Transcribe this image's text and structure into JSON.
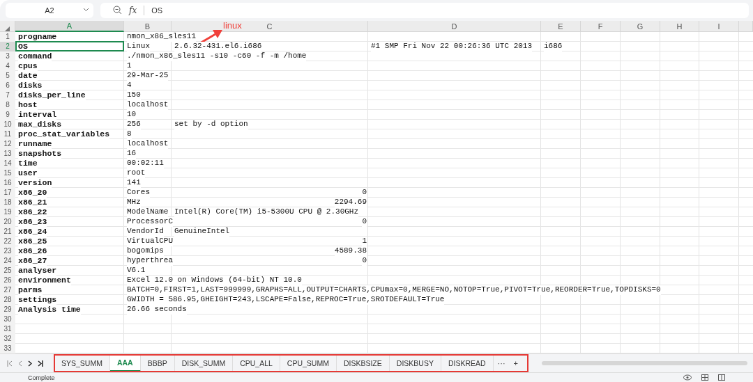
{
  "formula_bar": {
    "name_box": "A2",
    "fx": "fx",
    "value": "OS"
  },
  "columns": [
    {
      "label": "A",
      "selected": true
    },
    {
      "label": "B",
      "selected": false
    },
    {
      "label": "C",
      "selected": false
    },
    {
      "label": "D",
      "selected": false
    },
    {
      "label": "E",
      "selected": false
    },
    {
      "label": "F",
      "selected": false
    },
    {
      "label": "G",
      "selected": false
    },
    {
      "label": "H",
      "selected": false
    },
    {
      "label": "I",
      "selected": false
    }
  ],
  "rows": [
    {
      "number": "1",
      "selected": false,
      "a": "progname",
      "b": "nmon_x86_sles11"
    },
    {
      "number": "2",
      "selected": true,
      "a": "OS",
      "b": "Linux",
      "c": "2.6.32-431.el6.i686",
      "d": "#1 SMP Fri Nov 22 00:26:36 UTC 2013",
      "e": "i686"
    },
    {
      "number": "3",
      "selected": false,
      "a": "command",
      "b": "./nmon_x86_sles11 -s10 -c60 -f -m /home"
    },
    {
      "number": "4",
      "selected": false,
      "a": "cpus",
      "b": "1"
    },
    {
      "number": "5",
      "selected": false,
      "a": "date",
      "b": "29-Mar-25"
    },
    {
      "number": "6",
      "selected": false,
      "a": "disks",
      "b": "4"
    },
    {
      "number": "7",
      "selected": false,
      "a": "disks_per_line",
      "b": "150"
    },
    {
      "number": "8",
      "selected": false,
      "a": "host",
      "b": "localhost"
    },
    {
      "number": "9",
      "selected": false,
      "a": "interval",
      "b": "10"
    },
    {
      "number": "10",
      "selected": false,
      "a": "max_disks",
      "b": "256",
      "c": "set by -d option"
    },
    {
      "number": "11",
      "selected": false,
      "a": "proc_stat_variables",
      "b": "8"
    },
    {
      "number": "12",
      "selected": false,
      "a": "runname",
      "b": "localhost"
    },
    {
      "number": "13",
      "selected": false,
      "a": "snapshots",
      "b": "16"
    },
    {
      "number": "14",
      "selected": false,
      "a": "time",
      "b": "00:02:11"
    },
    {
      "number": "15",
      "selected": false,
      "a": "user",
      "b": "root"
    },
    {
      "number": "16",
      "selected": false,
      "a": "version",
      "b": "14i"
    },
    {
      "number": "17",
      "selected": false,
      "a": "x86_20",
      "b": "Cores",
      "c": "0",
      "c_numeric": true
    },
    {
      "number": "18",
      "selected": false,
      "a": "x86_21",
      "b": "MHz",
      "c": "2294.69",
      "c_numeric": true
    },
    {
      "number": "19",
      "selected": false,
      "a": "x86_22",
      "b": "ModelName",
      "c": "Intel(R) Core(TM) i5-5300U CPU @ 2.30GHz"
    },
    {
      "number": "20",
      "selected": false,
      "a": "x86_23",
      "b": "ProcessorC",
      "c": "0",
      "c_numeric": true
    },
    {
      "number": "21",
      "selected": false,
      "a": "x86_24",
      "b": "VendorId",
      "c": "GenuineIntel"
    },
    {
      "number": "22",
      "selected": false,
      "a": "x86_25",
      "b": "VirtualCPU",
      "c": "1",
      "c_numeric": true
    },
    {
      "number": "23",
      "selected": false,
      "a": "x86_26",
      "b": "bogomips",
      "c": "4589.38",
      "c_numeric": true
    },
    {
      "number": "24",
      "selected": false,
      "a": "x86_27",
      "b": "hyperthrea",
      "c": "0",
      "c_numeric": true
    },
    {
      "number": "25",
      "selected": false,
      "a": "analyser",
      "b": "V6.1"
    },
    {
      "number": "26",
      "selected": false,
      "a": "environment",
      "b": "Excel 12.0 on Windows (64-bit) NT 10.0"
    },
    {
      "number": "27",
      "selected": false,
      "a": "parms",
      "b": "BATCH=0,FIRST=1,LAST=999999,GRAPHS=ALL,OUTPUT=CHARTS,CPUmax=0,MERGE=NO,NOTOP=True,PIVOT=True,REORDER=True,TOPDISKS=0"
    },
    {
      "number": "28",
      "selected": false,
      "a": "settings",
      "b": "GWIDTH = 586.95,GHEIGHT=243,LSCAPE=False,REPROC=True,SROTDEFAULT=True"
    },
    {
      "number": "29",
      "selected": false,
      "a": "Analysis time",
      "b": "26.66 seconds"
    },
    {
      "number": "30",
      "selected": false
    },
    {
      "number": "31",
      "selected": false
    },
    {
      "number": "32",
      "selected": false
    },
    {
      "number": "33",
      "selected": false
    }
  ],
  "annotation": {
    "label": "linux"
  },
  "sheet_tabs": [
    {
      "label": "SYS_SUMM",
      "selected": false
    },
    {
      "label": "AAA",
      "selected": true
    },
    {
      "label": "BBBP",
      "selected": false
    },
    {
      "label": "DISK_SUMM",
      "selected": false
    },
    {
      "label": "CPU_ALL",
      "selected": false
    },
    {
      "label": "CPU_SUMM",
      "selected": false
    },
    {
      "label": "DISKBSIZE",
      "selected": false
    },
    {
      "label": "DISKBUSY",
      "selected": false
    },
    {
      "label": "DISKREAD",
      "selected": false
    }
  ],
  "more_tabs": "···",
  "add_tab": "+",
  "status_bar": {
    "text": "Complete"
  }
}
